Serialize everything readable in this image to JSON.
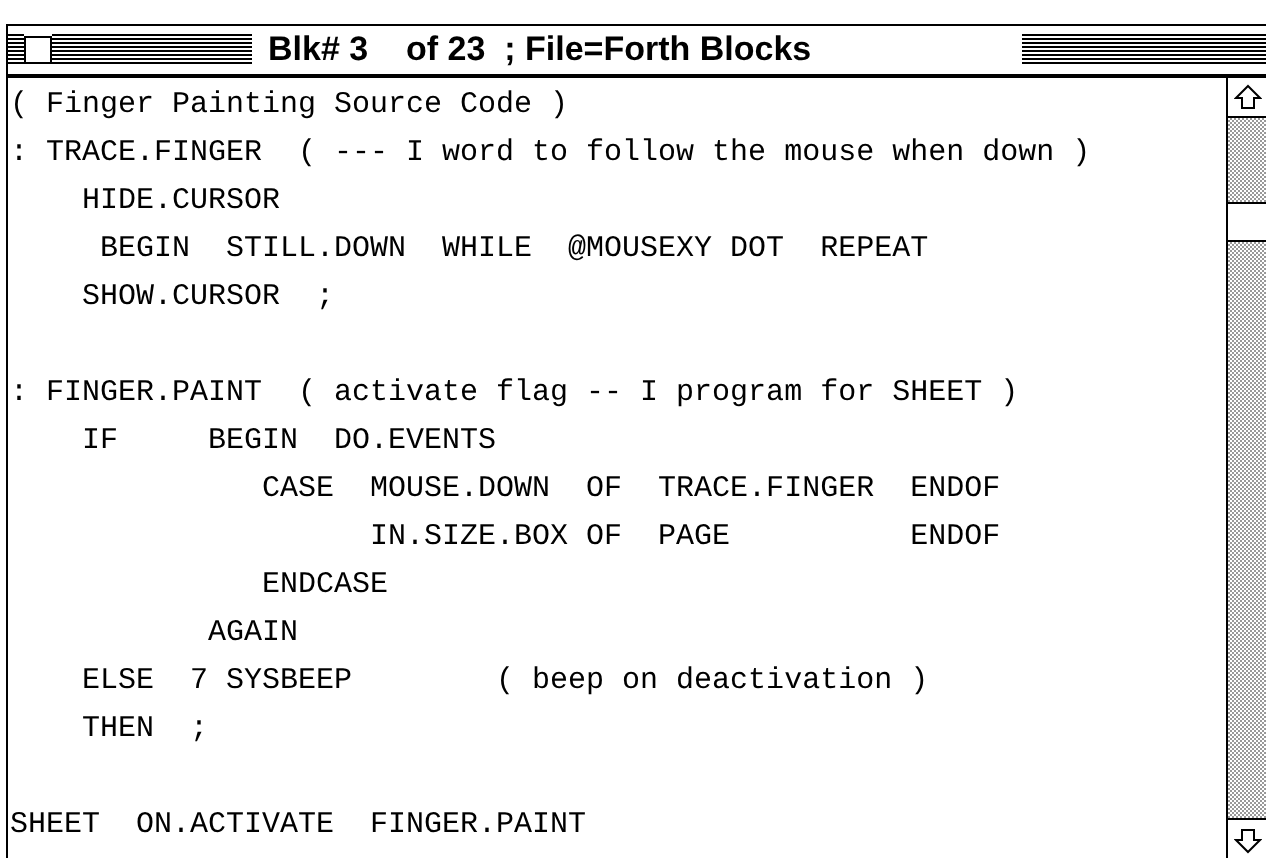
{
  "window": {
    "title": "Blk# 3    of 23  ; File=Forth Blocks"
  },
  "editor": {
    "lines": [
      {
        "kind": "code",
        "text": "( Finger Painting Source Code )"
      },
      {
        "kind": "code",
        "text": ": TRACE.FINGER  ( --- I word to follow the mouse when down )"
      },
      {
        "kind": "code",
        "text": "    HIDE.CURSOR"
      },
      {
        "kind": "code",
        "text": "     BEGIN  STILL.DOWN  WHILE  @MOUSEXY DOT  REPEAT"
      },
      {
        "kind": "code",
        "text": "    SHOW.CURSOR  ;"
      },
      {
        "kind": "blank"
      },
      {
        "kind": "code",
        "text": ": FINGER.PAINT  ( activate flag -- I program for SHEET )"
      },
      {
        "kind": "code",
        "text": "    IF     BEGIN  DO.EVENTS"
      },
      {
        "kind": "code",
        "text": "              CASE  MOUSE.DOWN  OF  TRACE.FINGER  ENDOF"
      },
      {
        "kind": "code",
        "text": "                    IN.SIZE.BOX OF  PAGE          ENDOF"
      },
      {
        "kind": "code",
        "text": "              ENDCASE"
      },
      {
        "kind": "code",
        "text": "           AGAIN"
      },
      {
        "kind": "code",
        "text": "    ELSE  7 SYSBEEP        ( beep on deactivation )"
      },
      {
        "kind": "code",
        "text": "    THEN  ;"
      },
      {
        "kind": "blank"
      },
      {
        "kind": "code",
        "text": "SHEET  ON.ACTIVATE  FINGER.PAINT"
      }
    ]
  }
}
